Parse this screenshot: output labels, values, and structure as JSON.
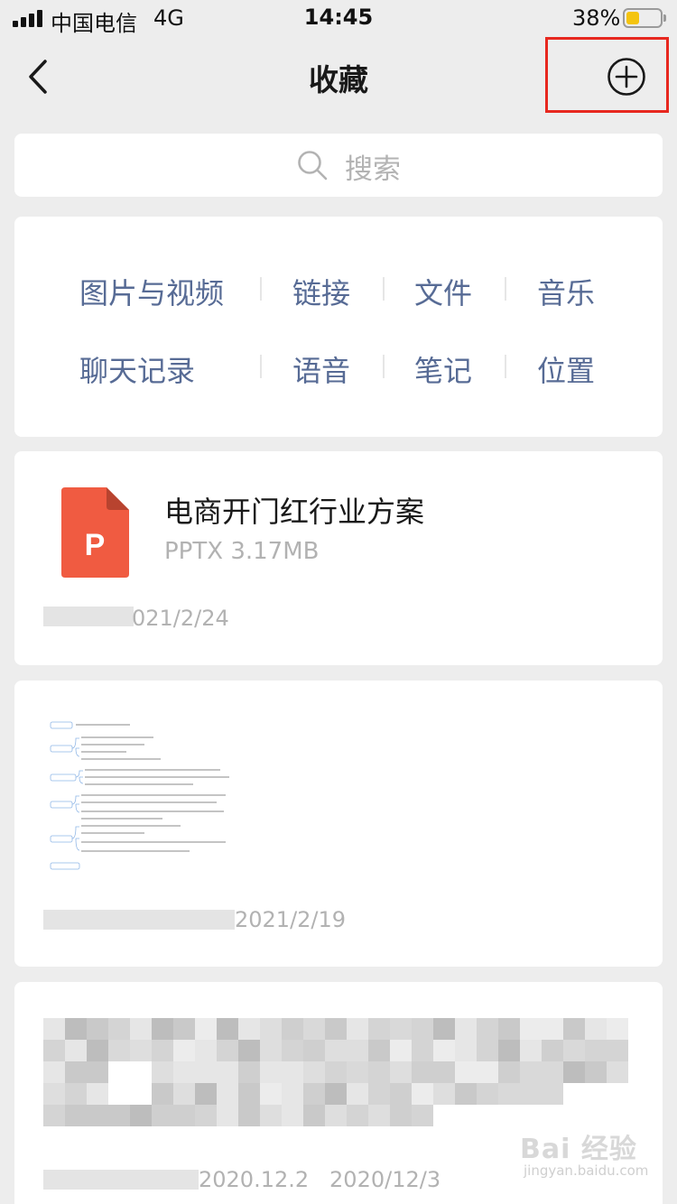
{
  "status_bar": {
    "carrier": "中国电信",
    "network": "4G",
    "time": "14:45",
    "battery_percent": "38%",
    "battery_level": 0.38,
    "battery_color": "#f4c40e"
  },
  "nav": {
    "back_icon": "chevron-left-icon",
    "title": "收藏",
    "add_icon": "plus-circle-icon",
    "highlight_color": "#e7281f"
  },
  "search": {
    "icon": "search-icon",
    "placeholder": "搜索"
  },
  "categories": {
    "row1": [
      "图片与视频",
      "链接",
      "文件",
      "音乐"
    ],
    "row2": [
      "聊天记录",
      "语音",
      "笔记",
      "位置"
    ],
    "color": "#576b95"
  },
  "items": [
    {
      "type": "file",
      "icon": "pptx-file-icon",
      "icon_letter": "P",
      "icon_color": "#f05b41",
      "name": "电商开门红行业方案",
      "meta": "PPTX 3.17MB",
      "date": "021/2/24"
    },
    {
      "type": "image",
      "icon": "mindmap-thumbnail",
      "date": "2021/2/19"
    },
    {
      "type": "text",
      "dates": "2020.12.2   2020/12/3"
    }
  ],
  "watermark": {
    "main": "Bai 经验",
    "sub": "jingyan.baidu.com"
  }
}
